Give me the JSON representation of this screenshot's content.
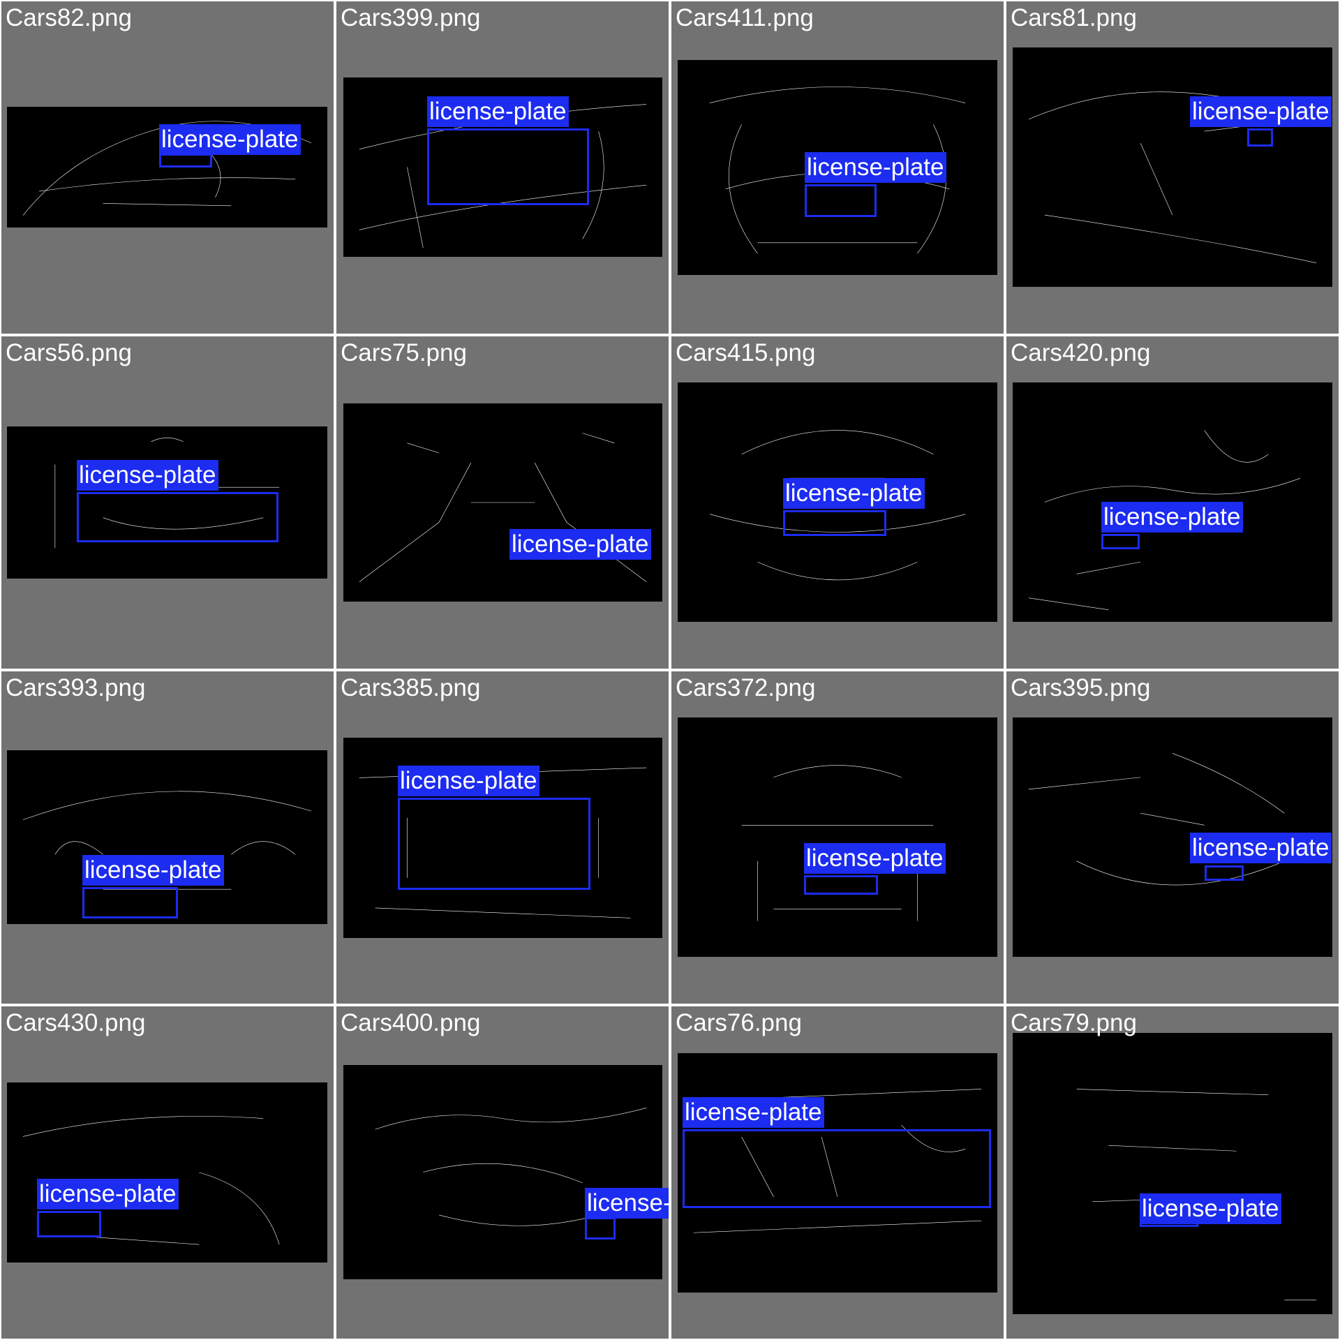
{
  "mosaic": {
    "label_color": "#1c2cf0",
    "cell_background": "#727272",
    "images": [
      {
        "file": "Cars82.png",
        "detections": [
          "license-plate"
        ]
      },
      {
        "file": "Cars399.png",
        "detections": [
          "license-plate"
        ]
      },
      {
        "file": "Cars411.png",
        "detections": [
          "license-plate"
        ]
      },
      {
        "file": "Cars81.png",
        "detections": [
          "license-plate"
        ]
      },
      {
        "file": "Cars56.png",
        "detections": [
          "license-plate"
        ]
      },
      {
        "file": "Cars75.png",
        "detections": [
          "license-plate"
        ]
      },
      {
        "file": "Cars415.png",
        "detections": [
          "license-plate"
        ]
      },
      {
        "file": "Cars420.png",
        "detections": [
          "license-plate"
        ]
      },
      {
        "file": "Cars393.png",
        "detections": [
          "license-plate"
        ]
      },
      {
        "file": "Cars385.png",
        "detections": [
          "license-plate"
        ]
      },
      {
        "file": "Cars372.png",
        "detections": [
          "license-plate"
        ]
      },
      {
        "file": "Cars395.png",
        "detections": [
          "license-plate"
        ]
      },
      {
        "file": "Cars430.png",
        "detections": [
          "license-plate"
        ]
      },
      {
        "file": "Cars400.png",
        "detections": [
          "license-plate"
        ]
      },
      {
        "file": "Cars76.png",
        "detections": [
          "license-plate"
        ]
      },
      {
        "file": "Cars79.png",
        "detections": [
          "license-plate"
        ]
      }
    ]
  }
}
